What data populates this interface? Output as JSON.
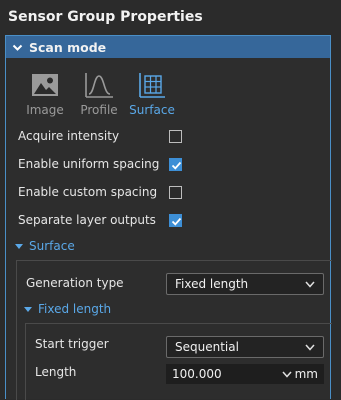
{
  "title": "Sensor Group Properties",
  "scan_mode": {
    "header": "Scan mode",
    "tabs": [
      {
        "label": "Image",
        "icon": "image-icon",
        "active": false
      },
      {
        "label": "Profile",
        "icon": "profile-icon",
        "active": false
      },
      {
        "label": "Surface",
        "icon": "surface-icon",
        "active": true
      }
    ],
    "options": [
      {
        "label": "Acquire intensity",
        "checked": false
      },
      {
        "label": "Enable uniform spacing",
        "checked": true
      },
      {
        "label": "Enable custom spacing",
        "checked": false
      },
      {
        "label": "Separate layer outputs",
        "checked": true
      }
    ]
  },
  "surface": {
    "label": "Surface",
    "generation_type_label": "Generation type",
    "generation_type_value": "Fixed length",
    "fixed_length": {
      "label": "Fixed length",
      "start_trigger_label": "Start trigger",
      "start_trigger_value": "Sequential",
      "length_label": "Length",
      "length_value": "100.000",
      "length_unit": "mm"
    }
  },
  "colors": {
    "accent": "#5aa8e8",
    "header_bg": "#36679a",
    "checkbox_on": "#3d8fd6",
    "background": "#2b2b2b"
  }
}
